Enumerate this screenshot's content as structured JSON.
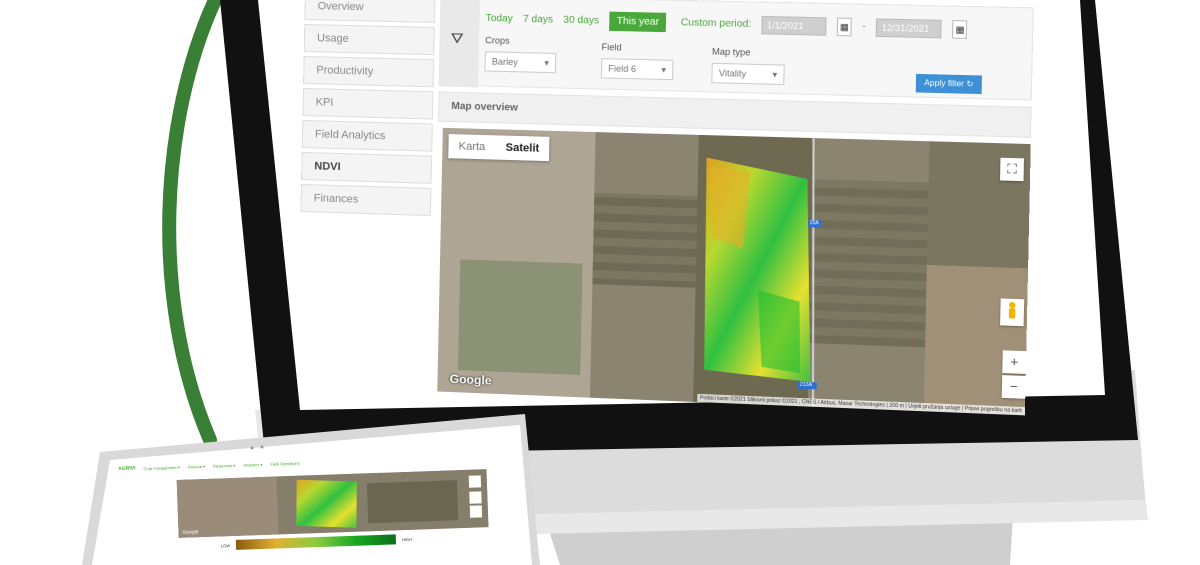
{
  "sidebar": {
    "items": [
      {
        "label": "Overview"
      },
      {
        "label": "Usage"
      },
      {
        "label": "Productivity"
      },
      {
        "label": "KPI"
      },
      {
        "label": "Field Analytics"
      },
      {
        "label": "NDVI"
      },
      {
        "label": "Finances"
      }
    ],
    "active": "NDVI"
  },
  "filters": {
    "periods": [
      {
        "label": "Today"
      },
      {
        "label": "7 days"
      },
      {
        "label": "30 days"
      },
      {
        "label": "This year"
      }
    ],
    "active_period": "This year",
    "custom_label": "Custom period:",
    "date_from": "1/1/2021",
    "date_to": "12/31/2021",
    "crops_label": "Crops",
    "crops_value": "Barley",
    "field_label": "Field",
    "field_value": "Field 6",
    "maptype_label": "Map type",
    "maptype_value": "Vitality",
    "apply_label": "Apply filter"
  },
  "map": {
    "section_title": "Map overview",
    "tabs": [
      "Karta",
      "Satelit"
    ],
    "active_tab": "Satelit",
    "road_label_1": "15A",
    "road_label_2": "213A",
    "google_label": "Google",
    "attribution": "Podaci karte ©2021 Slikovni prikaz ©2021 , CNES / Airbus, Maxar Technologies | 200 m | Uvjeti pružanja usluge | Prijavi pogrešku na karti"
  },
  "laptop": {
    "logo": "AGRIVI",
    "nav": [
      "Crop management ▾",
      "Finance ▾",
      "Resources ▾",
      "Analytics ▾",
      "Field Operations"
    ],
    "google_label": "Google",
    "legend_low": "LOW",
    "legend_high": "HIGH"
  },
  "colors": {
    "brand_green": "#4aa83b",
    "apply_blue": "#3d8fd6",
    "arrow_green": "#3a7f36"
  }
}
